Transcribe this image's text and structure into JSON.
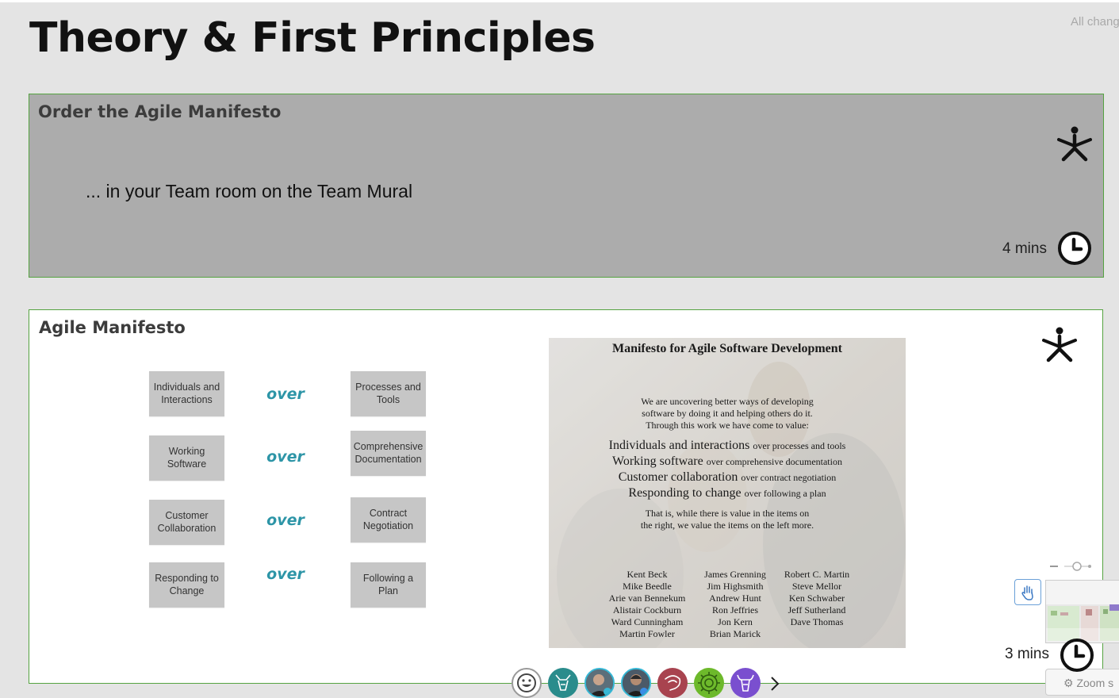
{
  "page": {
    "title": "Theory & First Principles",
    "saved_status": "All chang"
  },
  "card1": {
    "title": "Order the Agile Manifesto",
    "body": "... in your Team room on the Team Mural",
    "time": "4 mins",
    "person_icon": "exercise-person-icon",
    "clock_icon": "clock-icon"
  },
  "card2": {
    "title": "Agile Manifesto",
    "time": "3 mins",
    "rows": [
      {
        "left": "Individuals and Interactions",
        "connector": "over",
        "right": "Processes and Tools"
      },
      {
        "left": "Working Software",
        "connector": "over",
        "right": "Comprehensive Documentation"
      },
      {
        "left": "Customer Collaboration",
        "connector": "over",
        "right": "Contract Negotiation"
      },
      {
        "left": "Responding to Change",
        "connector": "over",
        "right": "Following a Plan"
      }
    ],
    "manifesto_image": {
      "title": "Manifesto for Agile Software Development",
      "intro": [
        "We are uncovering better ways of developing",
        "software by doing it and helping others do it.",
        "Through this work we have come to value:"
      ],
      "values": [
        {
          "left": "Individuals and interactions",
          "right": "over processes and tools"
        },
        {
          "left": "Working software",
          "right": "over comprehensive documentation"
        },
        {
          "left": "Customer collaboration",
          "right": "over contract negotiation"
        },
        {
          "left": "Responding to change",
          "right": "over following a plan"
        }
      ],
      "closing": [
        "That is, while there is value in the items on",
        "the right, we value the items on the left more."
      ],
      "signatories": [
        [
          "Kent Beck",
          "Mike Beedle",
          "Arie van Bennekum",
          "Alistair Cockburn",
          "Ward Cunningham",
          "Martin Fowler"
        ],
        [
          "James Grenning",
          "Jim Highsmith",
          "Andrew Hunt",
          "Ron Jeffries",
          "Jon Kern",
          "Brian Marick"
        ],
        [
          "Robert C. Martin",
          "Steve Mellor",
          "Ken Schwaber",
          "Jeff Sutherland",
          "Dave Thomas"
        ]
      ]
    }
  },
  "controls": {
    "zoom_label": "Zoom s",
    "hand_icon": "hand-pan-icon",
    "gear_icon": "gear-icon"
  },
  "collaborators": [
    {
      "icon": "smiley-icon",
      "color": "#ffffff"
    },
    {
      "icon": "goat-icon",
      "color": "#2a8c8c"
    },
    {
      "icon": "person-photo-icon",
      "color": "#3d5a6b"
    },
    {
      "icon": "person-photo-icon",
      "color": "#3b4a5b"
    },
    {
      "icon": "shrimp-icon",
      "color": "#a8434f"
    },
    {
      "icon": "sun-badge-icon",
      "color": "#6db92b"
    },
    {
      "icon": "ox-icon",
      "color": "#7a4fcf"
    }
  ],
  "colors": {
    "card_border": "#55a341",
    "over_text": "#2d95a7",
    "sticky_bg": "#c6c6c6"
  }
}
